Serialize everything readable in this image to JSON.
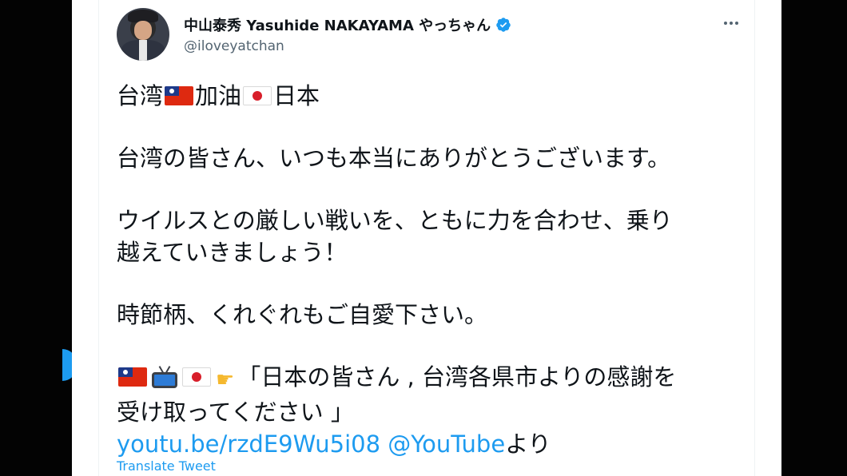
{
  "tweet": {
    "author_name": "中山泰秀 Yasuhide NAKAYAMA やっちゃん",
    "handle": "@iloveyatchan",
    "line1_a": "台湾",
    "line1_b": "加油",
    "line1_c": "日本",
    "line2": "台湾の皆さん、いつも本当にありがとうございます。",
    "line3": "ウイルスとの厳しい戦いを、ともに力を合わせ、乗り",
    "line4": "越えていきましょう！",
    "line5": "時節柄、くれぐれもご自愛下さい。",
    "line6": "「日本の皆さん , 台湾各県市よりの感謝を",
    "line7": "受け取ってください 」",
    "link_url": "youtu.be/rzdE9Wu5i08",
    "link_mention": "@YouTube",
    "link_suffix": "より",
    "translate_label": "Translate Tweet"
  },
  "icons": {
    "verified": "verified-badge-icon",
    "more": "more-options-icon",
    "flag_taiwan": "taiwan-flag-icon",
    "flag_japan": "japan-flag-icon",
    "tv": "television-icon",
    "pointing": "pointing-right-icon"
  },
  "colors": {
    "link": "#1d9bf0",
    "text": "#0f1419",
    "secondary": "#536471"
  }
}
